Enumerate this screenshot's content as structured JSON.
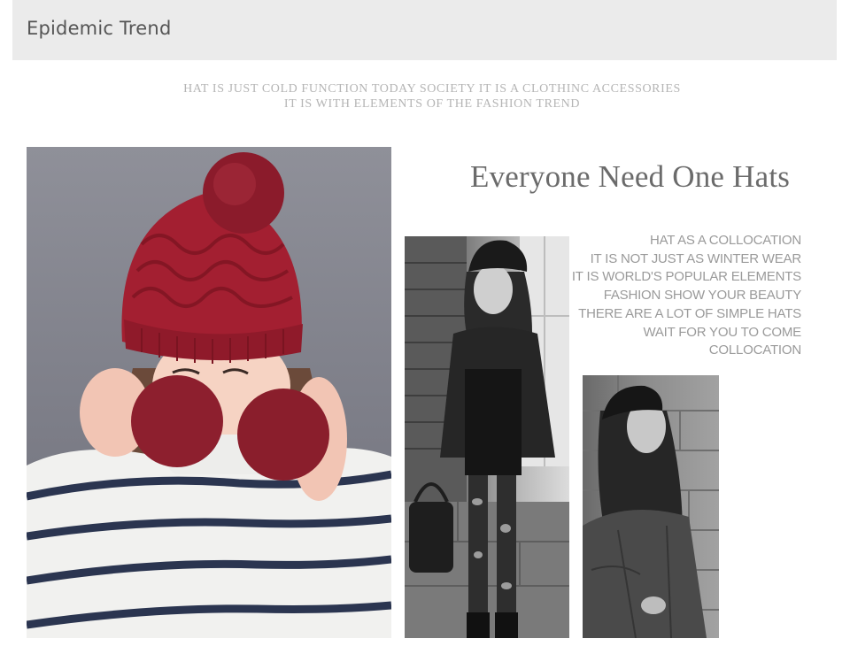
{
  "header": {
    "title": "Epidemic Trend"
  },
  "intro": {
    "line1": "HAT IS JUST COLD  FUNCTION  TODAY  SOCIETY IT IS A CLOTHINC ACCESSORIES",
    "line2": "IT IS WITH ELEMENTS OF THE FASHION TREND"
  },
  "feature": {
    "headline": "Everyone Need One Hats",
    "lines": [
      "HAT AS A COLLOCATION",
      "IT IS NOT JUST AS WINTER WEAR",
      "IT IS WORLD'S POPULAR ELEMENTS",
      "FASHION SHOW YOUR BEAUTY",
      "THERE ARE A LOT OF SIMPLE HATS",
      "WAIT FOR YOU TO COME",
      "COLLOCATION"
    ]
  },
  "colors": {
    "hat_red": "#9c1c2c",
    "stripe_navy": "#2b3550",
    "backdrop_gray": "#858690"
  }
}
